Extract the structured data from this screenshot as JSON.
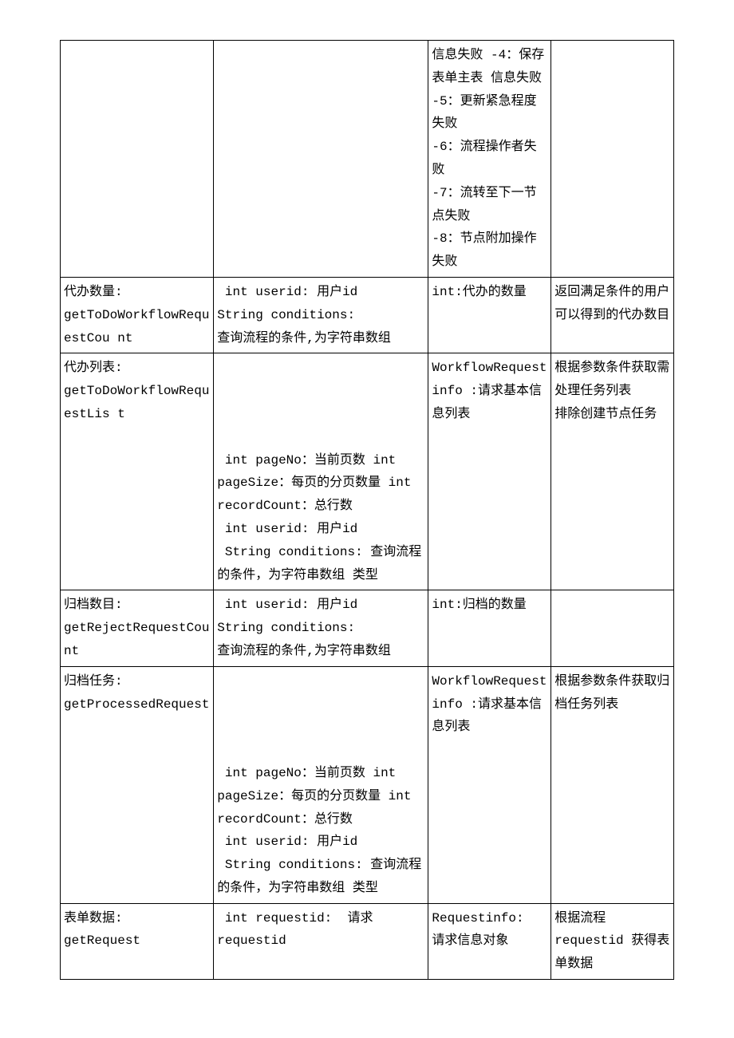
{
  "rows": [
    {
      "c1": "",
      "c2": "",
      "c3": "信息失败 -4：保存表单主表 信息失败\n-5：更新紧急程度失败\n-6：流程操作者失败\n-7：流转至下一节点失败\n-8：节点附加操作失败",
      "c4": ""
    },
    {
      "c1": "代办数量:\ngetToDoWorkflowRequestCou nt",
      "c2": " int userid: 用户id\nString conditions:\n查询流程的条件,为字符串数组",
      "c3": "int:代办的数量",
      "c4": "返回满足条件的用户可以得到的代办数目"
    },
    {
      "c1": "代办列表:\ngetToDoWorkflowRequestLis t",
      "c2": "\n\n\n\n int pageNo：当前页数 int pageSize：每页的分页数量 int recordCount：总行数\n int userid: 用户id\n String conditions: 查询流程的条件，为字符串数组 类型",
      "c3": "WorkflowRequestinfo :请求基本信息列表",
      "c4": "根据参数条件获取需处理任务列表\n排除创建节点任务"
    },
    {
      "c1": "归档数目:\ngetRejectRequestCount",
      "c2": " int userid: 用户id\nString conditions:\n查询流程的条件,为字符串数组",
      "c3": "int:归档的数量",
      "c4": ""
    },
    {
      "c1": "归档任务:\ngetProcessedRequest",
      "c2": "\n\n\n\n int pageNo：当前页数 int pageSize：每页的分页数量 int recordCount：总行数\n int userid: 用户id\n String conditions: 查询流程的条件，为字符串数组 类型",
      "c3": "WorkflowRequestinfo :请求基本信息列表",
      "c4": "根据参数条件获取归档任务列表"
    },
    {
      "c1": "表单数据:   getRequest",
      "c2": " int requestid:  请求 requestid",
      "c3": "Requestinfo:  请求信息对象",
      "c4": "根据流程requestid 获得表单数据"
    }
  ]
}
